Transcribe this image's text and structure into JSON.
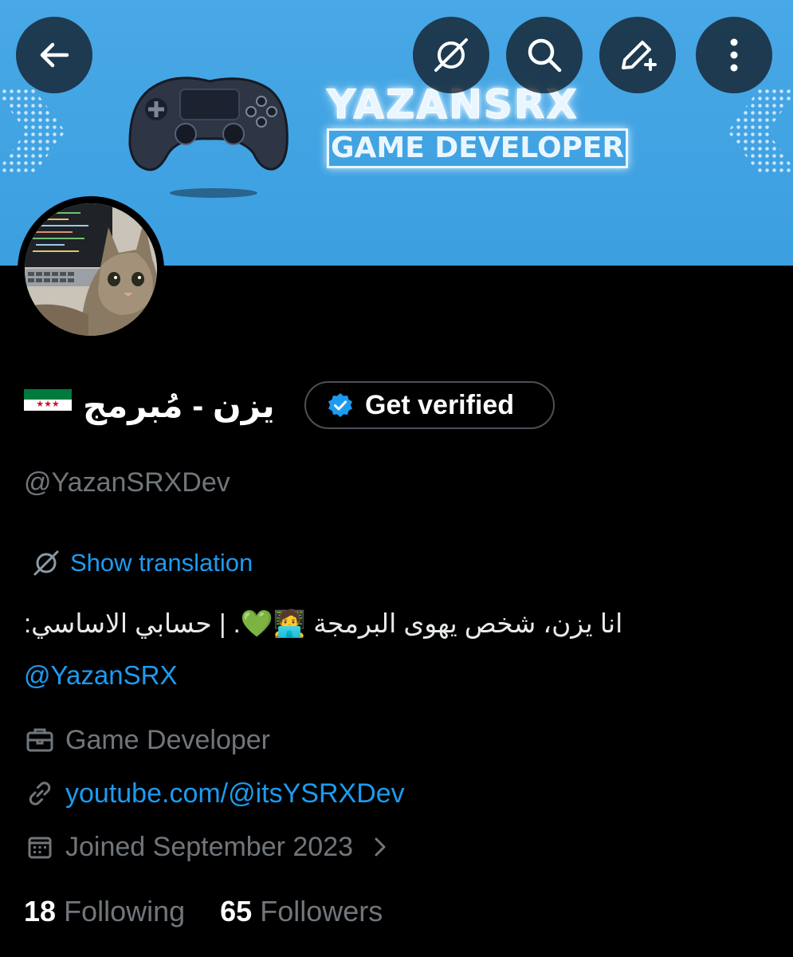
{
  "profile": {
    "display_name": "يزن - مُبرمج",
    "flag_icon": "syria-revolution-flag-icon",
    "verify_label": "Get verified",
    "handle": "@YazanSRXDev",
    "translate_label": "Show translation",
    "bio_text": "انا يزن، شخص يهوى البرمجة 🧑‍💻💚. | حسابي الاساسي:",
    "bio_mention": "@YazanSRX",
    "profession": "Game Developer",
    "website": "youtube.com/@itsYSRXDev",
    "joined": "Joined September 2023",
    "following_count": "18",
    "following_label": "Following",
    "followers_count": "65",
    "followers_label": "Followers"
  },
  "banner": {
    "title_line1": "YAZANSRX",
    "title_line2": "GAME DEVELOPER"
  },
  "toolbar": {
    "back_icon": "arrow-left-icon",
    "translate_icon": "translate-icon",
    "search_icon": "search-icon",
    "edit_icon": "edit-icon",
    "more_icon": "more-vertical-icon"
  },
  "colors": {
    "accent": "#1d9bf0",
    "muted": "#71767b",
    "banner": "#3b9fe0",
    "flag_green": "#007a3d",
    "flag_white": "#ffffff",
    "flag_black": "#000000",
    "flag_star": "#ce1126"
  }
}
